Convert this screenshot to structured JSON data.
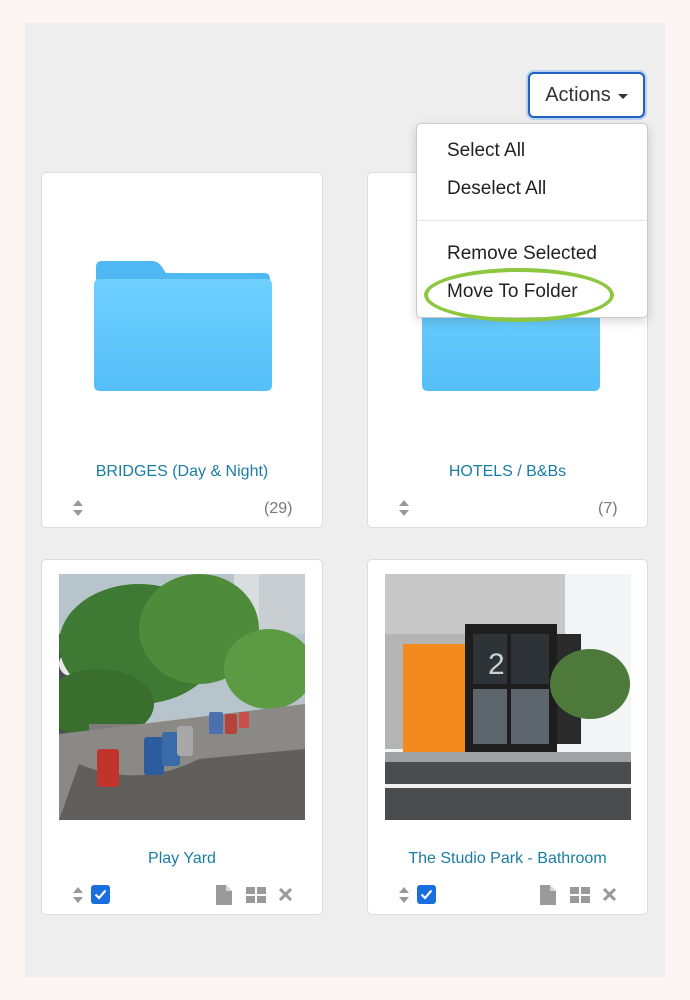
{
  "toolbar": {
    "actions_label": "Actions"
  },
  "menu": {
    "items": [
      {
        "label": "Select All"
      },
      {
        "label": "Deselect All"
      },
      {
        "label": "Remove Selected"
      },
      {
        "label": "Move To Folder"
      }
    ]
  },
  "folders": [
    {
      "title": "BRIDGES (Day & Night)",
      "count": "(29)"
    },
    {
      "title": "HOTELS / B&Bs",
      "count": "(7)"
    }
  ],
  "photos": [
    {
      "title": "Play Yard",
      "checked": true
    },
    {
      "title": "The Studio Park - Bathroom",
      "checked": true
    }
  ],
  "icons": {
    "folder": "folder-icon",
    "sort": "sort-icon",
    "file": "file-icon",
    "grid": "grid-icon",
    "remove": "close-icon",
    "caret": "caret-down-icon"
  },
  "colors": {
    "accent": "#1f62c2",
    "link": "#1a7da6",
    "folder": "#5bc8fb",
    "highlight": "#8dc63f",
    "checkbox": "#1a6fe0"
  }
}
